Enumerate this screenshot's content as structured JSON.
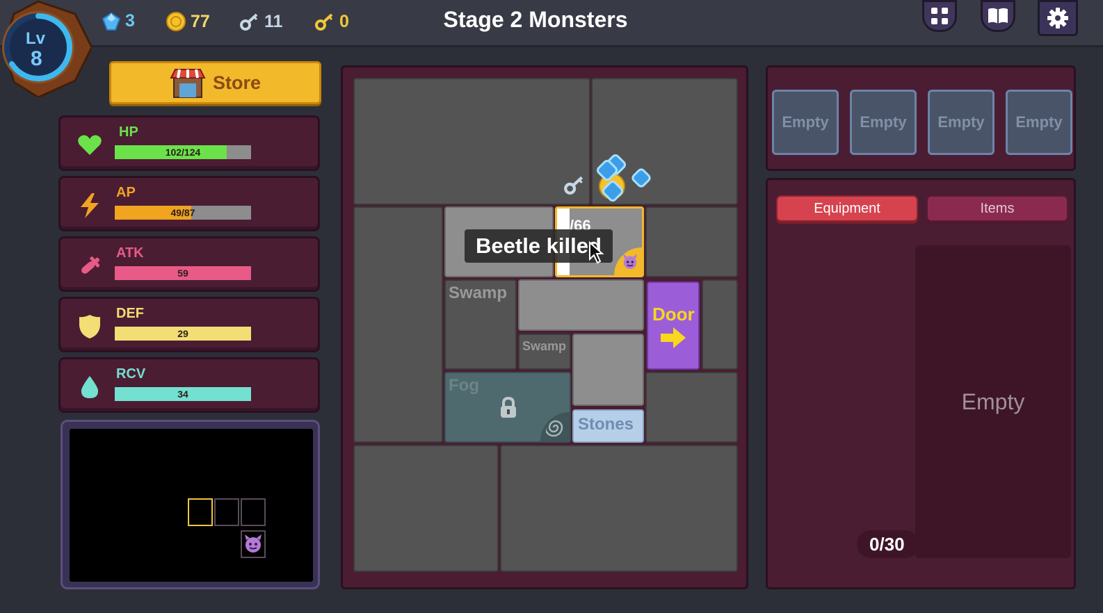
{
  "header": {
    "title": "Stage 2  Monsters",
    "level_prefix": "Lv",
    "level": "8",
    "resources": [
      {
        "icon": "gem-icon",
        "value": "3",
        "color": "#6ec6f5"
      },
      {
        "icon": "coin-icon",
        "value": "77",
        "color": "#f5d66a"
      },
      {
        "icon": "silver-key-icon",
        "value": "11",
        "color": "#c7d7e6"
      },
      {
        "icon": "gold-key-icon",
        "value": "0",
        "color": "#f2c63a"
      }
    ],
    "buttons": [
      "fullscreen-icon",
      "book-icon",
      "gear-icon"
    ]
  },
  "store": {
    "label": "Store"
  },
  "stats": [
    {
      "name": "HP",
      "value_text": "102/124",
      "current": 102,
      "max": 124,
      "color": "#6be24a",
      "label_color": "#6be24a",
      "icon": "heart-icon"
    },
    {
      "name": "AP",
      "value_text": "49/87",
      "current": 49,
      "max": 87,
      "color": "#f0a420",
      "label_color": "#f0a420",
      "icon": "lightning-icon"
    },
    {
      "name": "ATK",
      "value_text": "59",
      "current": 1,
      "max": 1,
      "color": "#e85a87",
      "label_color": "#e85a87",
      "icon": "sword-icon"
    },
    {
      "name": "DEF",
      "value_text": "29",
      "current": 1,
      "max": 1,
      "color": "#f2de74",
      "label_color": "#f2de74",
      "icon": "shield-icon"
    },
    {
      "name": "RCV",
      "value_text": "34",
      "current": 1,
      "max": 1,
      "color": "#74e0cf",
      "label_color": "#74e0cf",
      "icon": "drop-icon"
    }
  ],
  "board": {
    "labels": {
      "swamp_large": "Swamp",
      "swamp_small": "Swamp",
      "door": "Door",
      "fog": "Fog",
      "stones": "Stones",
      "monster_hp": "/66"
    },
    "toast": "Beetle killed"
  },
  "equipment_slots": [
    "Empty",
    "Empty",
    "Empty",
    "Empty"
  ],
  "inventory": {
    "tabs": [
      "Equipment",
      "Items"
    ],
    "empty_label": "Empty",
    "counter": "0/30"
  }
}
